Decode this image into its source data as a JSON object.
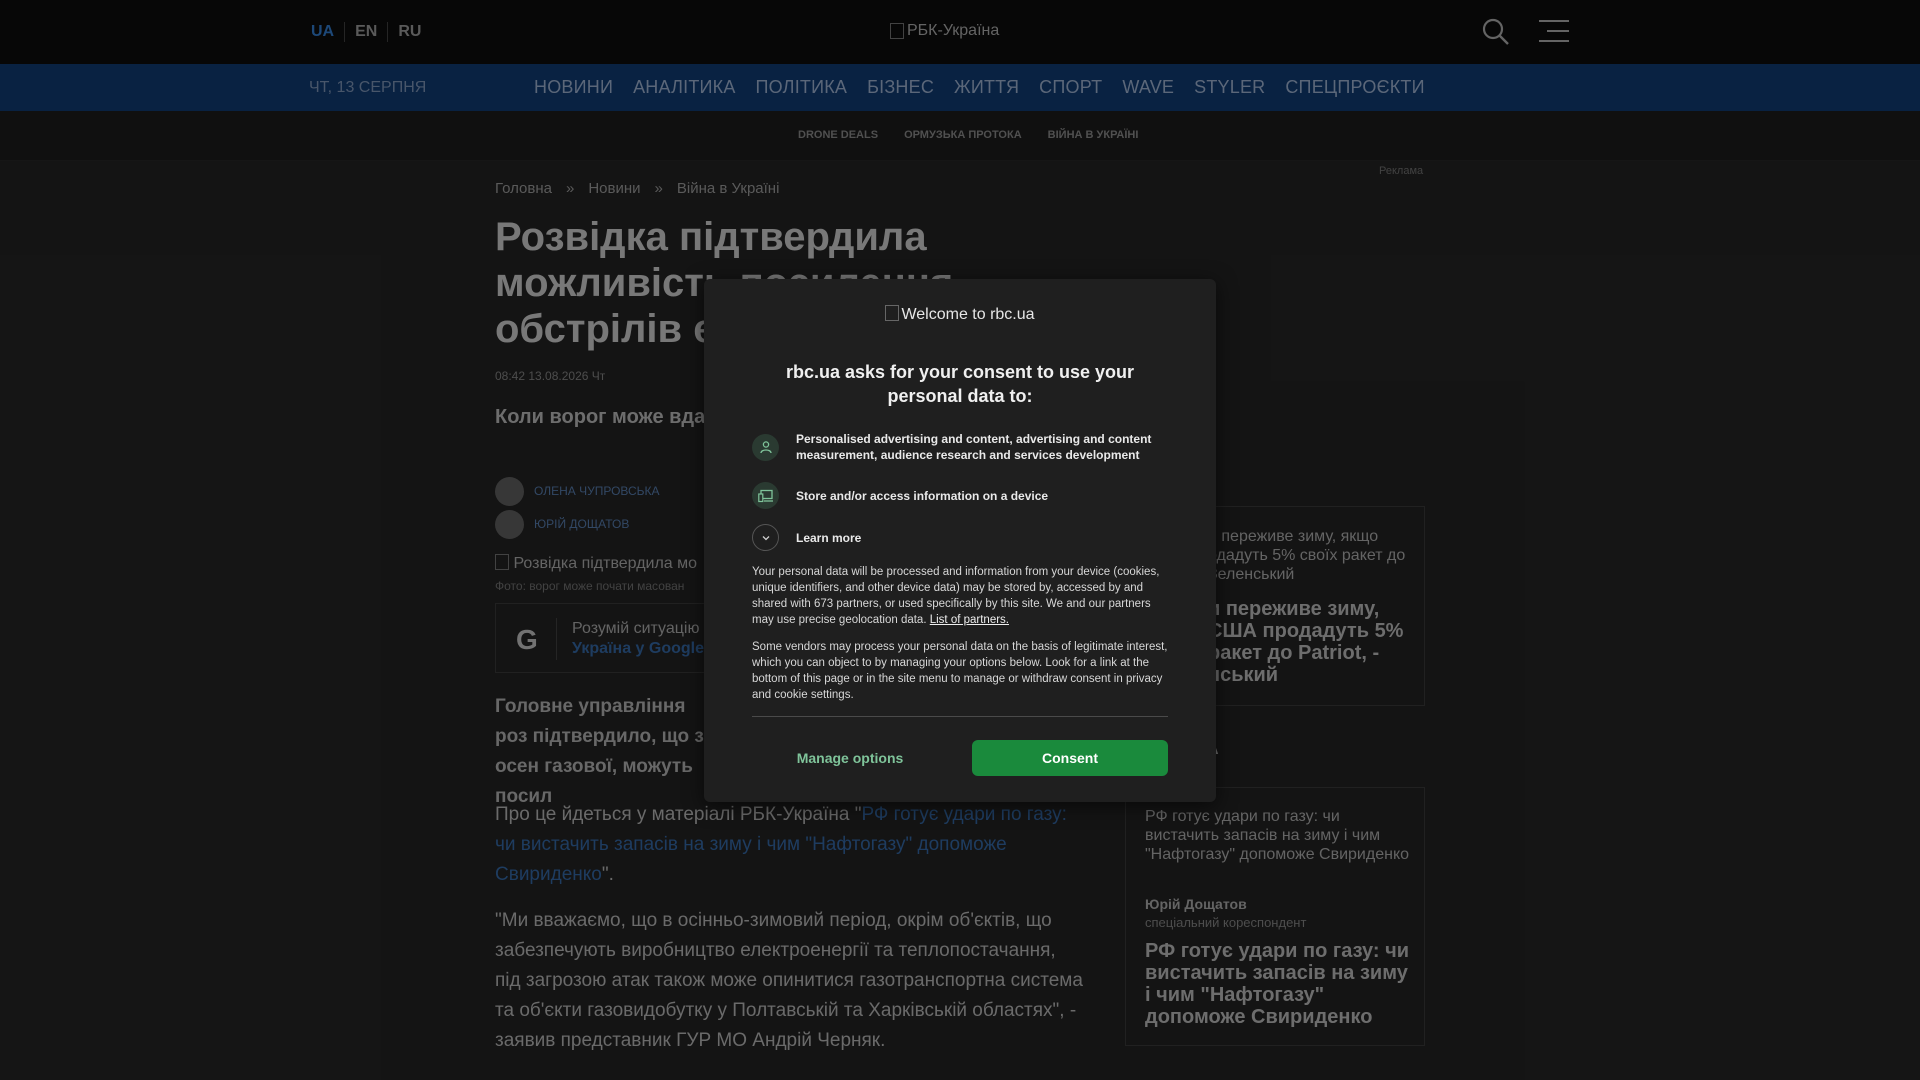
{
  "header": {
    "languages": [
      "UA",
      "EN",
      "RU"
    ],
    "logo_alt": "РБК-Україна"
  },
  "nav": {
    "date": "ЧТ, 13 СЕРПНЯ",
    "items": [
      "НОВИНИ",
      "АНАЛІТИКА",
      "ПОЛІТИКА",
      "БІЗНЕС",
      "ЖИТТЯ",
      "СПОРТ",
      "WAVE",
      "STYLER",
      "СПЕЦПРОЄКТИ"
    ]
  },
  "subnav": {
    "items": [
      "DRONE DEALS",
      "ОРМУЗЬКА ПРОТОКА",
      "ВІЙНА В УКРАЇНІ"
    ]
  },
  "article": {
    "ad_label": "Реклама",
    "breadcrumbs": [
      "Головна",
      "Новини",
      "Війна в Україні"
    ],
    "breadcrumb_sep": "»",
    "title": "Розвідка підтвердила можливість посилення обстрілів е",
    "meta": "08:42 13.08.2026 Чт",
    "lead": "Коли ворог може вдат енергетики?",
    "authors": [
      "ОЛЕНА ЧУПРОВСЬКА",
      "ЮРІЙ ДОЩАТОВ"
    ],
    "photo_alt": "Розвідка підтвердила мо",
    "photo_caption": "Фото: ворог може почати масован",
    "google": {
      "icon": "G",
      "line1": "Розумій ситуацію",
      "line2": "Україна у Google"
    },
    "body_bold": "Головне управління роз підтвердило, що з осен газової, можуть посил",
    "para1_prefix": "Про це йдеться у матеріалі РБК-Україна \"",
    "para1_link": "РФ готує удари по газу: чи вистачить запасів на зиму і чим \"Нафтогазу\" допоможе Свириденко",
    "para1_suffix": "\".",
    "para2": "\"Ми вважаємо, що в осінньо-зимовий період, окрім об'єктів, що забезпечують виробництво електроенергії та теплопостачання, під загрозою атак також може опинитися газотранспортна система та об'єкти газовидобутку у Полтавській та Харківській областях\", - заявив представник ГУР МО Андрій Черняк."
  },
  "sidebar": {
    "card1_alt": "и переживе зиму, якщо одадуть 5% своїх ракет до Зеленський",
    "card1_title": "и переживе зиму, США продадуть 5% ракет до Patriot, - нський",
    "heading": "КА",
    "card2_alt": "РФ готує удари по газу: чи вистачить запасів на зиму і чим \"Нафтогазу\" допоможе Свириденко",
    "card2_author": "Юрій Дощатов",
    "card2_role": "спеціальний кореспондент",
    "card2_title": "РФ готує удари по газу: чи вистачить запасів на зиму і чим \"Нафтогазу\" допоможе Свириденко"
  },
  "consent": {
    "logo_alt": "Welcome to rbc.ua",
    "heading": "rbc.ua asks for your consent to use your personal data to:",
    "purposes": [
      {
        "icon": "person-icon",
        "text": "Personalised advertising and content, advertising and content measurement, audience research and services development"
      },
      {
        "icon": "device-icon",
        "text": "Store and/or access information on a device"
      }
    ],
    "learn_more": "Learn more",
    "body1": "Your personal data will be processed and information from your device (cookies, unique identifiers, and other device data) may be stored by, accessed by and shared with 673 partners, or used specifically by this site. We and our partners may use precise geolocation data.",
    "partners_link": "List of partners.",
    "body2": "Some vendors may process your personal data on the basis of legitimate interest, which you can object to by managing your options below. Look for a link at the bottom of this page or in the site menu to manage or withdraw consent in privacy and cookie settings.",
    "manage_label": "Manage options",
    "consent_label": "Consent",
    "accent_color": "#1a8a3c"
  }
}
